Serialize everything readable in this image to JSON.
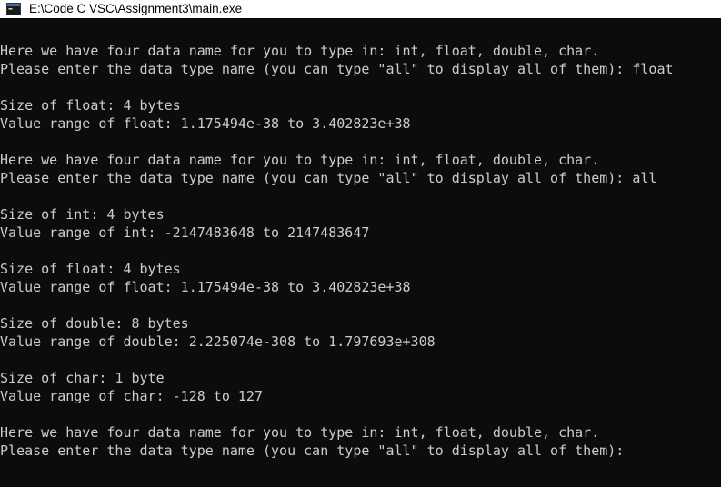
{
  "window": {
    "title": "E:\\Code C VSC\\Assignment3\\main.exe",
    "title_bar_color": "#ffffff",
    "console_background": "#0c0c0c",
    "console_text_color": "#cccccc"
  },
  "console": {
    "lines": [
      "Here we have four data name for you to type in: int, float, double, char.",
      "Please enter the data type name (you can type \"all\" to display all of them): float",
      "",
      "Size of float: 4 bytes",
      "Value range of float: 1.175494e-38 to 3.402823e+38",
      "",
      "Here we have four data name for you to type in: int, float, double, char.",
      "Please enter the data type name (you can type \"all\" to display all of them): all",
      "",
      "Size of int: 4 bytes",
      "Value range of int: -2147483648 to 2147483647",
      "",
      "Size of float: 4 bytes",
      "Value range of float: 1.175494e-38 to 3.402823e+38",
      "",
      "Size of double: 8 bytes",
      "Value range of double: 2.225074e-308 to 1.797693e+308",
      "",
      "Size of char: 1 byte",
      "Value range of char: -128 to 127",
      "",
      "Here we have four data name for you to type in: int, float, double, char.",
      "Please enter the data type name (you can type \"all\" to display all of them): "
    ]
  }
}
